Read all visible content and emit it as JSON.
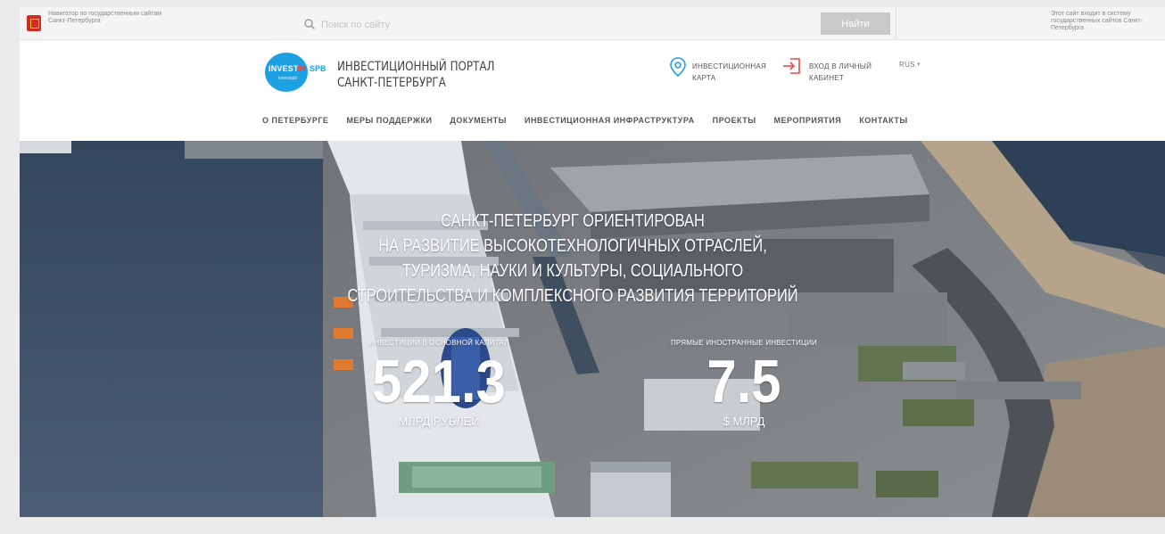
{
  "gov_bar": {
    "left_text": "Навигатор по государственным сайтам Санкт-Петербурга",
    "search_placeholder": "Поиск по сайту",
    "search_button": "Найти",
    "right_text": "Этот сайт входит в систему государственных сайтов Санкт-Петербурга"
  },
  "header": {
    "logo": {
      "invest": "INVEST",
      "in": "IN",
      "spb": "SPB",
      "sub": "investspb"
    },
    "title_line1": "ИНВЕСТИЦИОННЫЙ ПОРТАЛ",
    "title_line2": "САНКТ-ПЕТЕРБУРГА",
    "map_link_line1": "ИНВЕСТИЦИОННАЯ",
    "map_link_line2": "КАРТА",
    "login_line1": "ВХОД В ЛИЧНЫЙ",
    "login_line2": "КАБИНЕТ",
    "language": "RUS"
  },
  "nav": {
    "items": [
      "О ПЕТЕРБУРГЕ",
      "МЕРЫ ПОДДЕРЖКИ",
      "ДОКУМЕНТЫ",
      "ИНВЕСТИЦИОННАЯ ИНФРАСТРУКТУРА",
      "ПРОЕКТЫ",
      "МЕРОПРИЯТИЯ",
      "КОНТАКТЫ"
    ]
  },
  "hero": {
    "headline_lines": [
      "САНКТ-ПЕТЕРБУРГ ОРИЕНТИРОВАН",
      "НА РАЗВИТИЕ ВЫСОКОТЕХНОЛОГИЧНЫХ ОТРАСЛЕЙ,",
      "ТУРИЗМА, НАУКИ И КУЛЬТУРЫ, СОЦИАЛЬНОГО",
      "СТРОИТЕЛЬСТВА И КОМПЛЕКСНОГО РАЗВИТИЯ ТЕРРИТОРИЙ"
    ],
    "stats": [
      {
        "caption": "ИНВЕСТИЦИИ В ОСНОВНОЙ КАПИТАЛ",
        "value": "521.3",
        "unit": "МЛРД РУБЛЕЙ"
      },
      {
        "caption": "ПРЯМЫЕ ИНОСТРАННЫЕ ИНВЕСТИЦИИ",
        "value": "7.5",
        "unit": "$ МЛРД"
      }
    ]
  },
  "colors": {
    "brand_blue": "#1da1e2",
    "accent_red": "#e84c3d",
    "search_button_bg": "#c9c9c9"
  }
}
